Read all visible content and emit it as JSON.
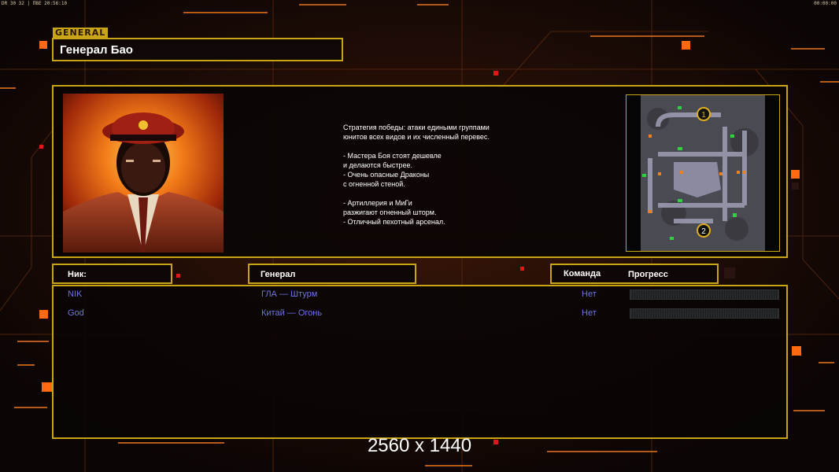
{
  "hud": {
    "left": "DR 30 32 | ПВЕ 20:56:10",
    "right": "00:00:00"
  },
  "general_tag": "GENERAL",
  "general_name": "Генерал Бао",
  "description": [
    "Стратегия победы: атаки едиными группами",
    "юнитов всех видов и их численный перевес.",
    "",
    "- Мастера Боя стоят дешевле",
    "и делаются быстрее.",
    "- Очень опасные Драконы",
    "с огненной стеной.",
    "",
    "- Артиллерия и МиГи",
    "разжигают огненный шторм.",
    "- Отличный пехотный арсенал."
  ],
  "minimap": {
    "start_positions": [
      "1",
      "2"
    ]
  },
  "columns": {
    "nick": "Ник:",
    "general": "Генерал",
    "team": "Команда",
    "progress": "Прогресс"
  },
  "players": [
    {
      "nick": "NIK",
      "general": "ГЛА — Штурм",
      "team": "Нет",
      "progress": 0
    },
    {
      "nick": "God",
      "general": "Китай — Огонь",
      "team": "Нет",
      "progress": 0
    }
  ],
  "resolution": "2560 x 1440",
  "colors": {
    "accent": "#c9a414",
    "player_text": "#6f74e6",
    "background": "#0d0605"
  }
}
